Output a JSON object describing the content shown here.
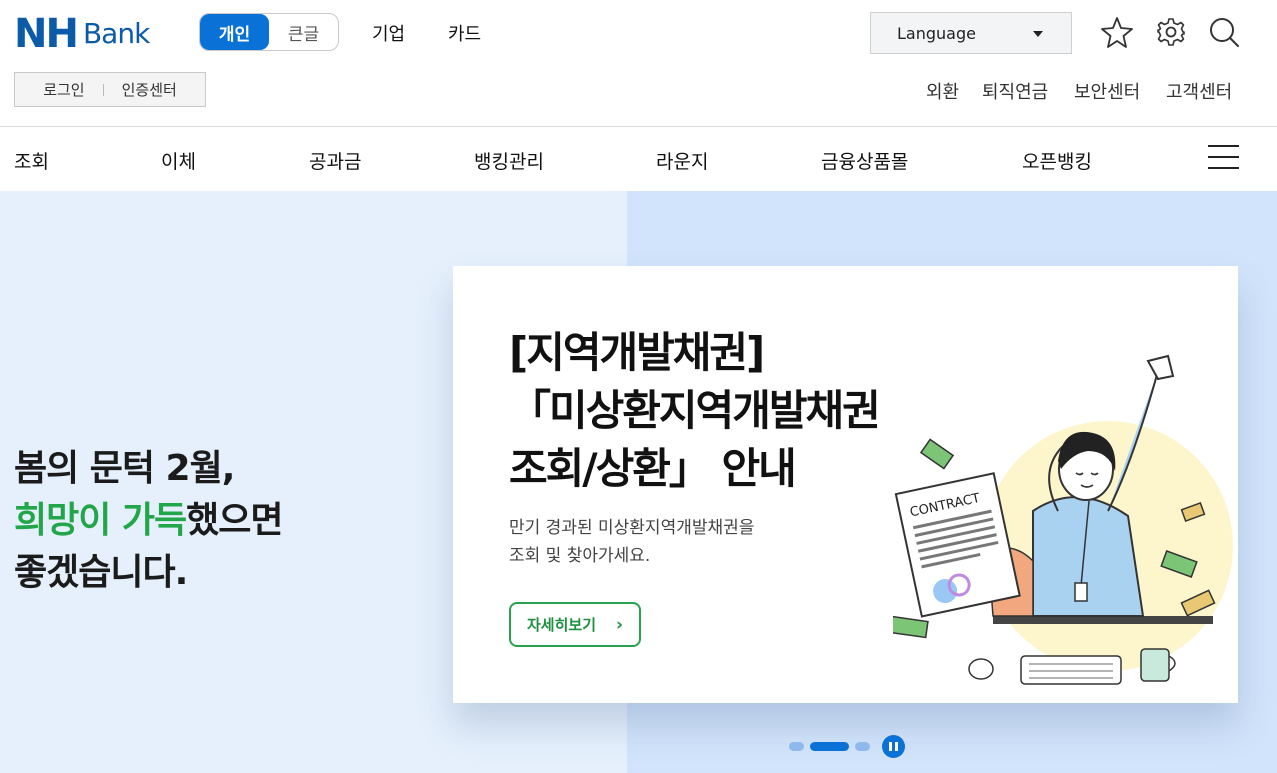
{
  "logo": {
    "brand": "NH",
    "product": "Bank"
  },
  "mode_toggle": {
    "personal": "개인",
    "large_text": "큰글",
    "active": "personal"
  },
  "top_links": {
    "corporate": "기업",
    "card": "카드"
  },
  "language_select": {
    "value": "Language"
  },
  "icons": {
    "favorite": "star-icon",
    "settings": "gear-icon",
    "search": "search-icon",
    "menu": "menu-icon"
  },
  "login_box": {
    "login": "로그인",
    "cert_center": "인증센터"
  },
  "util_links": [
    "외환",
    "퇴직연금",
    "보안센터",
    "고객센터"
  ],
  "gnb": [
    "조회",
    "이체",
    "공과금",
    "뱅킹관리",
    "라운지",
    "금융상품몰",
    "오픈뱅킹"
  ],
  "hero": {
    "line1": "봄의 문턱 2월,",
    "line2_highlight": "희망이 가득",
    "line2_rest": "했으면",
    "line3": "좋겠습니다."
  },
  "banner": {
    "title_line1": "[지역개발채권]",
    "title_line2": "「미상환지역개발채권",
    "title_line3": "조회/상환」 안내",
    "desc_line1": "만기 경과된 미상환지역개발채권을",
    "desc_line2": "조회 및 찾아가세요.",
    "button": "자세히보기",
    "illustration_text": "CONTRACT"
  },
  "carousel": {
    "slides": 3,
    "active": 2
  },
  "colors": {
    "brand_blue": "#0b5ba8",
    "accent_blue": "#0a72d6",
    "green": "#22a64a",
    "hero_bg": "#e5f0fc",
    "hero_bg_right": "#d2e4fb"
  }
}
